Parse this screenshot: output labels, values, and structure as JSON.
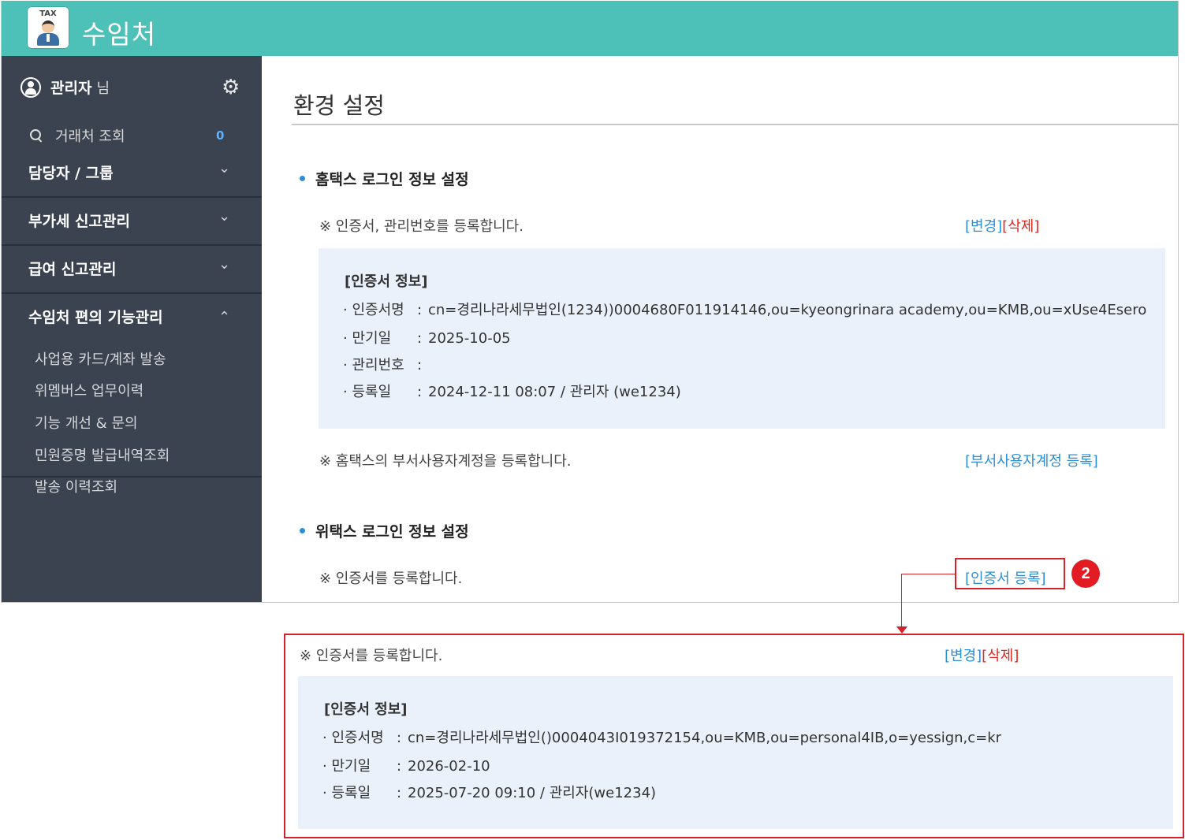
{
  "app": {
    "title": "수임처",
    "logo_text": "TAX"
  },
  "sidebar": {
    "user_name": "관리자",
    "user_suffix": "님",
    "search_label": "거래처 조회",
    "search_count": "0",
    "sections": [
      {
        "label": "담당자 / 그룹",
        "chevron": "chevron-down"
      },
      {
        "label": "부가세 신고관리",
        "chevron": "chevron-down"
      },
      {
        "label": "급여 신고관리",
        "chevron": "chevron-down"
      },
      {
        "label": "수임처 편의 기능관리",
        "chevron": "chevron-up"
      }
    ],
    "sub_items": [
      "사업용 카드/계좌 발송",
      "위멤버스 업무이력",
      "기능 개선 & 문의",
      "민원증명 발급내역조회",
      "발송 이력조회"
    ]
  },
  "main": {
    "title": "환경 설정",
    "hometax": {
      "heading": "홈택스 로그인 정보 설정",
      "note": "※ 인증서, 관리번호를 등록합니다.",
      "change_link": "[변경]",
      "delete_link": "[삭제]",
      "info_title": "[인증서 정보]",
      "rows": [
        {
          "key": "· 인증서명",
          "value": "cn=경리나라세무법인(1234))0004680F011914146,ou=kyeongrinara academy,ou=KMB,ou=xUse4Esero"
        },
        {
          "key": "· 만기일",
          "value": "2025-10-05"
        },
        {
          "key": "· 관리번호",
          "value": ""
        },
        {
          "key": "· 등록일",
          "value": "2024-12-11 08:07 / 관리자 (we1234)"
        }
      ],
      "dept_note": "※ 홈택스의 부서사용자계정을 등록합니다.",
      "dept_link": "[부서사용자계정 등록]"
    },
    "wetax": {
      "heading": "위택스 로그인 정보 설정",
      "note": "※ 인증서를 등록합니다.",
      "register_link": "[인증서 등록]",
      "badge": "2"
    }
  },
  "callout": {
    "note": "※ 인증서를 등록합니다.",
    "change_link": "[변경]",
    "delete_link": "[삭제]",
    "info_title": "[인증서 정보]",
    "rows": [
      {
        "key": "· 인증서명",
        "value": "cn=경리나라세무법인()0004043I019372154,ou=KMB,ou=personal4IB,o=yessign,c=kr"
      },
      {
        "key": "· 만기일",
        "value": "2026-02-10"
      },
      {
        "key": "· 등록일",
        "value": "2025-07-20 09:10 / 관리자(we1234)"
      }
    ]
  },
  "colors": {
    "header": "#4dc1b8",
    "sidebar": "#3b4350",
    "link": "#2b8fd6",
    "delete": "#e0261e",
    "info_bg": "#eaf1fa",
    "highlight": "#d6212a"
  }
}
